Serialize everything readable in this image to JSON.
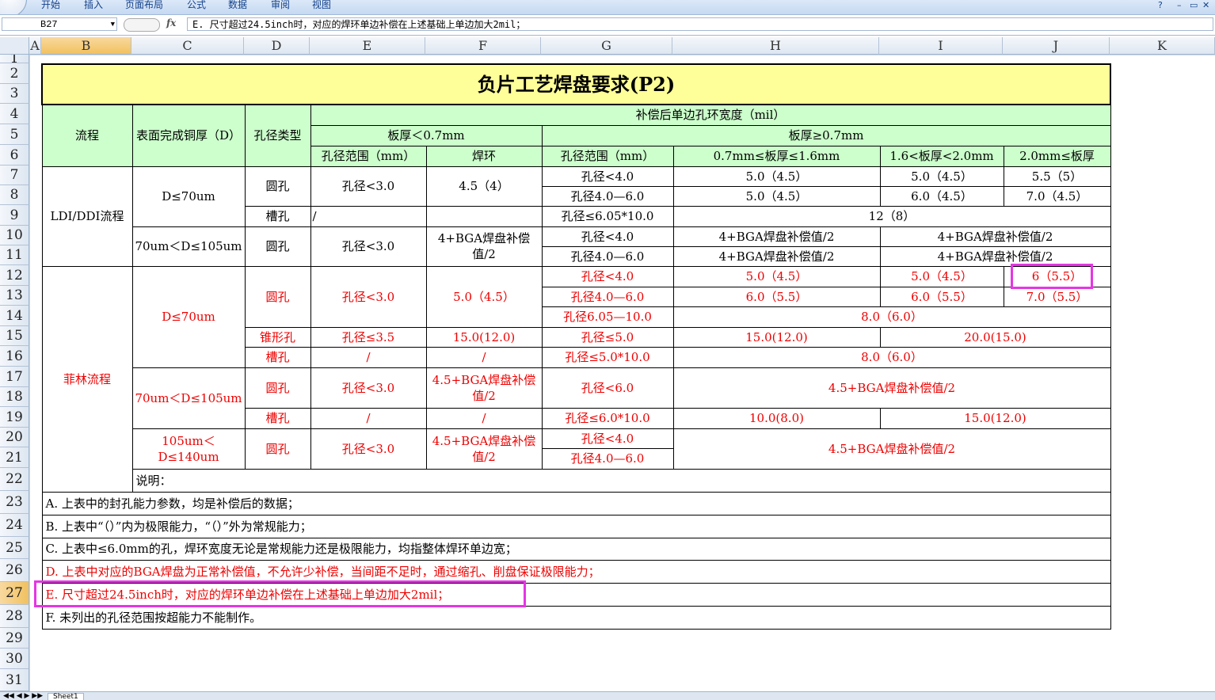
{
  "ribbon": {
    "tabs": [
      "开始",
      "插入",
      "页面布局",
      "公式",
      "数据",
      "审阅",
      "视图"
    ]
  },
  "formula_bar": {
    "cell_ref": "B27",
    "fx_label": "fx",
    "formula": "E. 尺寸超过24.5inch时，对应的焊环单边补偿在上述基础上单边加大2mil；"
  },
  "columns": [
    "A",
    "B",
    "C",
    "D",
    "E",
    "F",
    "G",
    "H",
    "I",
    "J",
    "K"
  ],
  "rows": [
    "1",
    "2",
    "3",
    "4",
    "5",
    "6",
    "7",
    "8",
    "9",
    "10",
    "11",
    "12",
    "13",
    "14",
    "15",
    "16",
    "17",
    "18",
    "19",
    "20",
    "21",
    "22",
    "23",
    "24",
    "25",
    "26",
    "27",
    "28",
    "29",
    "30",
    "31"
  ],
  "selected_row": "27",
  "selected_col": "B",
  "sheet_tab": "Sheet1",
  "table": {
    "title": "负片工艺焊盘要求(P2)",
    "h_flow": "流程",
    "h_copper": "表面完成铜厚（D）",
    "h_holetype": "孔径类型",
    "h_comp": "补偿后单边孔环宽度（mil）",
    "h_thin": "板厚＜0.7mm",
    "h_thick": "板厚≥0.7mm",
    "h_range1": "孔径范围（mm）",
    "h_ring": "焊环",
    "h_range2": "孔径范围（mm）",
    "h_t1": "0.7mm≤板厚≤1.6mm",
    "h_t2": "1.6<板厚<2.0mm",
    "h_t3": "2.0mm≤板厚",
    "ldi": "LDI/DDI流程",
    "d70": "D≤70um",
    "d70_105": "70um＜D≤105um",
    "round": "圆孔",
    "slot": "槽孔",
    "taper": "锥形孔",
    "lt30": "孔径<3.0",
    "ring45": "4.5（4）",
    "g_lt40": "孔径<4.0",
    "g_40_60": "孔径4.0—6.0",
    "v50_45": "5.0（4.5）",
    "v55_5": "5.5（5）",
    "v60_45": "6.0（4.5）",
    "v70_45": "7.0（4.5）",
    "slot_slash": "/",
    "slot_le605": "孔径≤6.05*10.0",
    "v12_8": "12（8）",
    "bga": "4+BGA焊盘补偿值/2",
    "fl": "菲林流程",
    "fl_d70": "D≤70um",
    "fl_d70_105": "70um＜D≤105um",
    "fl_d105_140": "105um＜D≤140um",
    "fl_ring50": "5.0（4.5）",
    "fl_g_lt40": "孔径<4.0",
    "fl_v50": "5.0（4.5）",
    "fl_v50b": "5.0（4.5）",
    "fl_v6": "6（5.5）",
    "fl_g_40_60": "孔径4.0—6.0",
    "fl_v60": "6.0（5.5）",
    "fl_v60b": "6.0（5.5）",
    "fl_v70": "7.0（5.5）",
    "fl_g_605_10": "孔径6.05—10.0",
    "fl_v80": "8.0（6.0）",
    "fl_le35": "孔径≤3.5",
    "fl_ring15": "15.0(12.0)",
    "fl_g_le50": "孔径≤5.0",
    "fl_v15": "15.0(12.0)",
    "fl_v20": "20.0(15.0)",
    "fl_slash": "/",
    "fl_g_le50x10": "孔径≤5.0*10.0",
    "fl_v80b": "8.0（6.0）",
    "fl_ring_bga": "4.5+BGA焊盘补偿值/2",
    "fl_g_lt60": "孔径<6.0",
    "fl_bga": "4.5+BGA焊盘补偿值/2",
    "fl_g_le60x10": "孔径≤6.0*10.0",
    "fl_v10": "10.0(8.0)",
    "fl_v15b": "15.0(12.0)",
    "notes": [
      "说明：",
      "A. 上表中的封孔能力参数，均是补偿后的数据；",
      "B. 上表中“（）”内为极限能力，“（）”外为常规能力；",
      "C. 上表中≤6.0mm的孔，焊环宽度无论是常规能力还是极限能力，均指整体焊环单边宽；",
      "D. 上表中对应的BGA焊盘为正常补偿值，不允许少补偿，当间距不足时，通过缩孔、削盘保证极限能力；",
      "E. 尺寸超过24.5inch时，对应的焊环单边补偿在上述基础上单边加大2mil；",
      "F. 未列出的孔径范围按超能力不能制作。"
    ]
  }
}
